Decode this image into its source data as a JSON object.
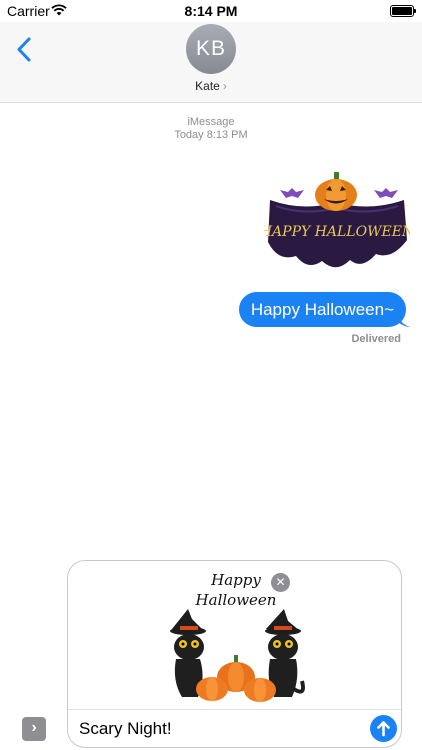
{
  "status_bar": {
    "carrier": "Carrier",
    "time": "8:14 PM"
  },
  "header": {
    "avatar_initials": "KB",
    "contact_name": "Kate",
    "contact_chevron": "›"
  },
  "conversation": {
    "service": "iMessage",
    "timestamp": "Today 8:13 PM",
    "sent_message": "Happy Halloween~",
    "delivery_status": "Delivered",
    "sticker_text": "HAPPY HALLOWEEN"
  },
  "composer": {
    "attachment_line1": "Happy",
    "attachment_line2": "Halloween",
    "remove_symbol": "✕",
    "input_value": "Scary Night!",
    "apps_symbol": "›"
  },
  "colors": {
    "accent": "#1b82f4",
    "bubble_text": "#ffffff",
    "meta_text": "#8e8e93",
    "header_bg": "#f7f7f7"
  },
  "icons": [
    "wifi-icon",
    "battery-icon",
    "back-chevron-icon",
    "chevron-right-icon",
    "pumpkin-icon",
    "black-cat-icon",
    "close-icon",
    "send-arrow-icon",
    "app-drawer-icon"
  ]
}
